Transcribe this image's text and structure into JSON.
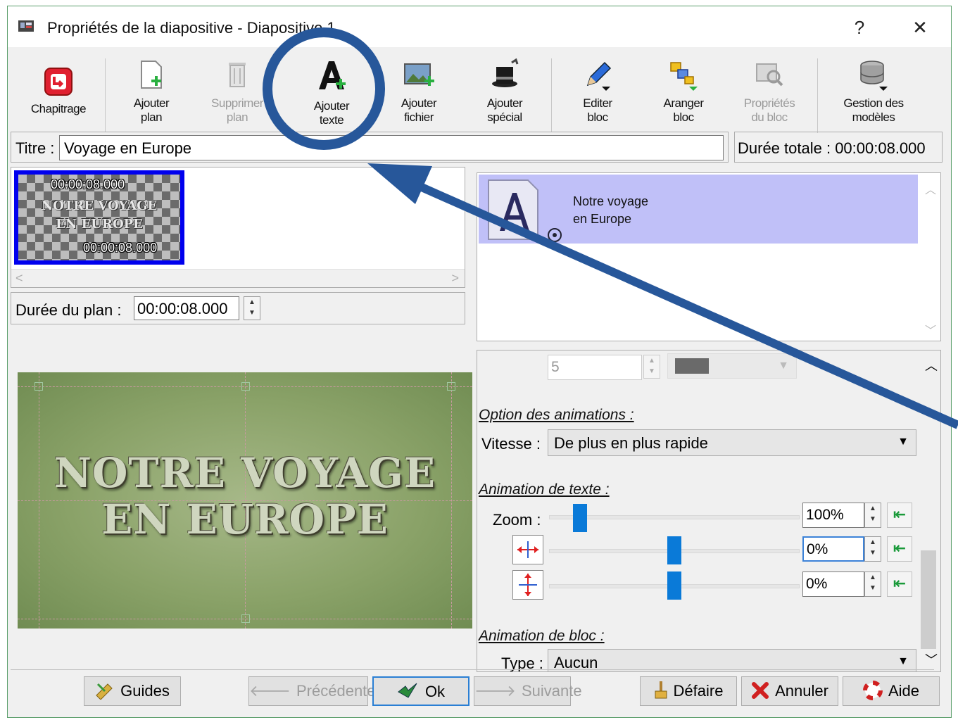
{
  "window": {
    "title": "Propriétés de la diapositive - Diapositive 1",
    "help_label": "?",
    "close_label": "✕"
  },
  "toolbar": {
    "chapitrage": "Chapitrage",
    "ajouter_plan": [
      "Ajouter",
      "plan"
    ],
    "supprimer_plan": [
      "Supprimer",
      "plan"
    ],
    "ajouter_texte": [
      "Ajouter",
      "texte"
    ],
    "ajouter_fichier": [
      "Ajouter",
      "fichier"
    ],
    "ajouter_special": [
      "Ajouter",
      "spécial"
    ],
    "editer_bloc": [
      "Editer",
      "bloc"
    ],
    "aranger_bloc": [
      "Aranger",
      "bloc"
    ],
    "proprietes_bloc": [
      "Propriétés",
      "du bloc"
    ],
    "gestion_modeles": [
      "Gestion des",
      "modèles"
    ]
  },
  "title_field": {
    "label": "Titre :",
    "value": "Voyage en Europe"
  },
  "total_duration": "Durée totale : 00:00:08.000",
  "plans": {
    "items": [
      {
        "start_time": "00:00:08.000",
        "end_time": "00:00:08.000",
        "text_lines": [
          "NOTRE VOYAGE",
          "EN EUROPE"
        ]
      }
    ],
    "scroll_left": "<",
    "scroll_right": ">"
  },
  "plan_duration": {
    "label": "Durée du plan :",
    "value": "00:00:08.000"
  },
  "preview": {
    "text_lines": [
      "NOTRE VOYAGE",
      "EN EUROPE"
    ]
  },
  "blocks": {
    "items": [
      {
        "text_lines": [
          "Notre voyage",
          "en Europe"
        ]
      }
    ]
  },
  "props": {
    "top_value": "5",
    "top_color": "#6a6a6a",
    "animation_options": {
      "section": "Option des animations :",
      "speed_label": "Vitesse :",
      "speed_value": "De plus en plus rapide"
    },
    "text_animation": {
      "section": "Animation de texte :",
      "zoom_label": "Zoom :",
      "zoom_value": "100%",
      "zoom_level": 0.1,
      "horizontal_value": "0%",
      "horizontal_level": 0.5,
      "vertical_value": "0%",
      "vertical_level": 0.5
    },
    "block_animation": {
      "section": "Animation de bloc :",
      "type_label": "Type :",
      "type_value": "Aucun"
    }
  },
  "buttons": {
    "guides": "Guides",
    "precedente": "Précédente",
    "ok": "Ok",
    "suivante": "Suivante",
    "defaire": "Défaire",
    "annuler": "Annuler",
    "aide": "Aide"
  },
  "colors": {
    "accent": "#0a7ad8",
    "selection": "#c0c0f8",
    "thumb_border": "#0000ee",
    "annotation": "#27579a"
  }
}
